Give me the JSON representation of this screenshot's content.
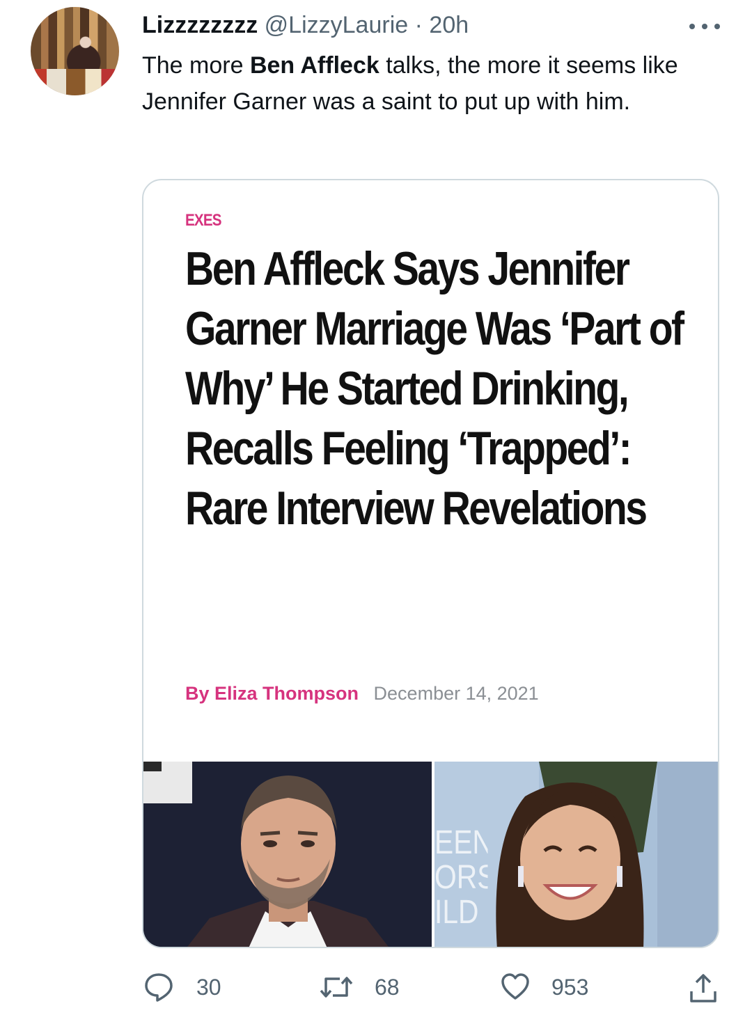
{
  "tweet": {
    "display_name": "Lizzzzzzzz",
    "handle": "@LizzyLaurie",
    "separator": "·",
    "time": "20h",
    "text_before": "The more ",
    "text_bold": "Ben Affleck",
    "text_after": " talks, the more it seems like Jennifer Garner was a saint to put up with him."
  },
  "card": {
    "category": "EXES",
    "headline": "Ben Affleck Says Jennifer Garner Marriage Was ‘Part of Why’ He Started Drinking, Recalls Feeling ‘Trapped’: Rare Interview Revelations",
    "author": "By Eliza Thompson",
    "date": "December 14, 2021",
    "backdrop_text": "EEN\nORS\nILD"
  },
  "actions": {
    "replies": "30",
    "retweets": "68",
    "likes": "953"
  },
  "icons": {
    "more": "more-horizontal-icon",
    "reply": "reply-bubble-icon",
    "retweet": "retweet-icon",
    "like": "heart-icon",
    "share": "share-icon"
  },
  "colors": {
    "accent_pink": "#d6337e",
    "meta_gray": "#536471",
    "border": "#cfd9de"
  }
}
